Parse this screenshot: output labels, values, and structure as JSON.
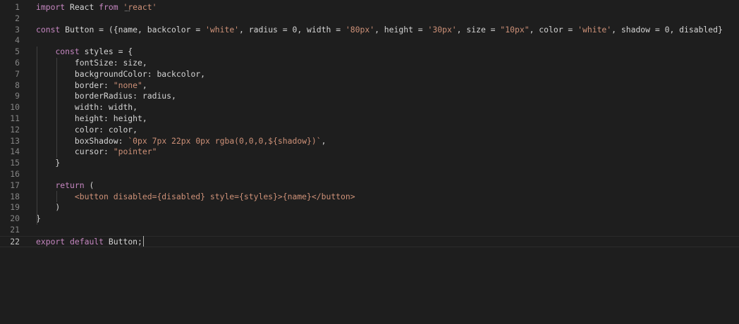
{
  "colors": {
    "background": "#1e1e1e",
    "keyword": "#c586c0",
    "string": "#ce9178",
    "text": "#d4d4d4",
    "line_number": "#858585"
  },
  "lines": [
    {
      "num": "1",
      "tokens": [
        {
          "t": "import",
          "k": "kw"
        },
        {
          "t": " React ",
          "k": "tx"
        },
        {
          "t": "from",
          "k": "kw"
        },
        {
          "t": " ",
          "k": "tx"
        },
        {
          "t": "'react'",
          "k": "st"
        }
      ]
    },
    {
      "num": "2",
      "tokens": []
    },
    {
      "num": "3",
      "tokens": [
        {
          "t": "const",
          "k": "kw"
        },
        {
          "t": " Button = ({name, backcolor = ",
          "k": "tx"
        },
        {
          "t": "'white'",
          "k": "st"
        },
        {
          "t": ", radius = 0, width = ",
          "k": "tx"
        },
        {
          "t": "'80px'",
          "k": "st"
        },
        {
          "t": ", height = ",
          "k": "tx"
        },
        {
          "t": "'30px'",
          "k": "st"
        },
        {
          "t": ", size = ",
          "k": "tx"
        },
        {
          "t": "\"10px\"",
          "k": "st"
        },
        {
          "t": ", color = ",
          "k": "tx"
        },
        {
          "t": "'white'",
          "k": "st"
        },
        {
          "t": ", shadow = 0, disabled}",
          "k": "tx"
        }
      ]
    },
    {
      "num": "4",
      "tokens": []
    },
    {
      "num": "5",
      "tokens": [
        {
          "t": "    ",
          "k": "tx"
        },
        {
          "t": "const",
          "k": "kw"
        },
        {
          "t": " styles = {",
          "k": "tx"
        }
      ]
    },
    {
      "num": "6",
      "tokens": [
        {
          "t": "        fontSize: size,",
          "k": "tx"
        }
      ]
    },
    {
      "num": "7",
      "tokens": [
        {
          "t": "        backgroundColor: backcolor,",
          "k": "tx"
        }
      ]
    },
    {
      "num": "8",
      "tokens": [
        {
          "t": "        border: ",
          "k": "tx"
        },
        {
          "t": "\"none\"",
          "k": "st"
        },
        {
          "t": ",",
          "k": "tx"
        }
      ]
    },
    {
      "num": "9",
      "tokens": [
        {
          "t": "        borderRadius: radius,",
          "k": "tx"
        }
      ]
    },
    {
      "num": "10",
      "tokens": [
        {
          "t": "        width: width,",
          "k": "tx"
        }
      ]
    },
    {
      "num": "11",
      "tokens": [
        {
          "t": "        height: height,",
          "k": "tx"
        }
      ]
    },
    {
      "num": "12",
      "tokens": [
        {
          "t": "        color: color,",
          "k": "tx"
        }
      ]
    },
    {
      "num": "13",
      "tokens": [
        {
          "t": "        boxShadow: ",
          "k": "tx"
        },
        {
          "t": "`0px 7px 22px 0px rgba(0,0,0,${shadow})`",
          "k": "st"
        },
        {
          "t": ",",
          "k": "tx"
        }
      ]
    },
    {
      "num": "14",
      "tokens": [
        {
          "t": "        cursor: ",
          "k": "tx"
        },
        {
          "t": "\"pointer\"",
          "k": "st"
        }
      ]
    },
    {
      "num": "15",
      "tokens": [
        {
          "t": "    }",
          "k": "tx"
        }
      ]
    },
    {
      "num": "16",
      "tokens": []
    },
    {
      "num": "17",
      "tokens": [
        {
          "t": "    ",
          "k": "tx"
        },
        {
          "t": "return",
          "k": "kw"
        },
        {
          "t": " (",
          "k": "tx"
        }
      ]
    },
    {
      "num": "18",
      "tokens": [
        {
          "t": "        <button disabled={disabled} style={styles}>{name}</button>",
          "k": "st"
        }
      ]
    },
    {
      "num": "19",
      "tokens": [
        {
          "t": "    )",
          "k": "tx"
        }
      ]
    },
    {
      "num": "20",
      "tokens": [
        {
          "t": "}",
          "k": "tx"
        }
      ]
    },
    {
      "num": "21",
      "tokens": []
    },
    {
      "num": "22",
      "tokens": [
        {
          "t": "export",
          "k": "kw"
        },
        {
          "t": " ",
          "k": "tx"
        },
        {
          "t": "default",
          "k": "kw"
        },
        {
          "t": " Button;",
          "k": "tx"
        }
      ]
    }
  ]
}
